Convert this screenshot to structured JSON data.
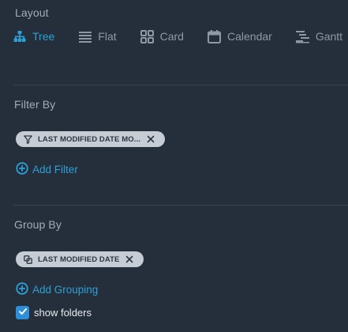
{
  "colors": {
    "background": "#252e3b",
    "accent": "#2ea0d8",
    "muted_text": "#8f99a6",
    "chip_bg": "#c6ccd4",
    "checkbox": "#2f8fd6"
  },
  "layout": {
    "title": "Layout",
    "options": [
      {
        "label": "Tree",
        "icon": "tree-icon",
        "active": true
      },
      {
        "label": "Flat",
        "icon": "list-icon",
        "active": false
      },
      {
        "label": "Card",
        "icon": "grid-icon",
        "active": false
      },
      {
        "label": "Calendar",
        "icon": "calendar-icon",
        "active": false
      },
      {
        "label": "Gantt",
        "icon": "gantt-icon",
        "active": false
      }
    ]
  },
  "filter": {
    "title": "Filter By",
    "chips": [
      {
        "label": "LAST MODIFIED DATE MO...",
        "icon": "funnel-icon"
      }
    ],
    "add_label": "Add Filter"
  },
  "group": {
    "title": "Group By",
    "chips": [
      {
        "label": "LAST MODIFIED DATE",
        "icon": "group-icon"
      }
    ],
    "add_label": "Add Grouping",
    "show_folders": {
      "label": "show folders",
      "checked": true
    }
  }
}
